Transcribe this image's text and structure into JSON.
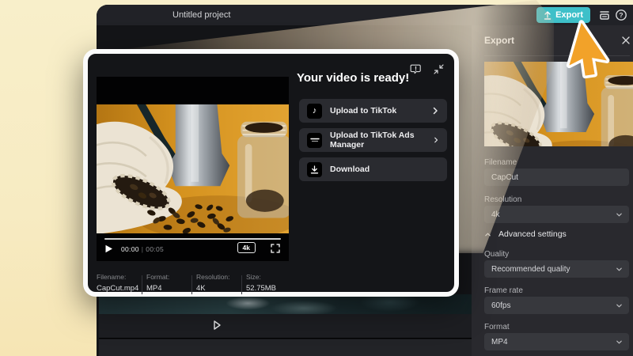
{
  "topbar": {
    "title": "Untitled project",
    "export_button": "Export",
    "help_glyph": "?"
  },
  "panel": {
    "title": "Export",
    "filename_label": "Filename",
    "filename_value": "CapCut",
    "resolution_label": "Resolution",
    "resolution_value": "4k",
    "advanced_label": "Advanced settings",
    "quality_label": "Quality",
    "quality_value": "Recommended quality",
    "framerate_label": "Frame rate",
    "framerate_value": "60fps",
    "format_label": "Format",
    "format_value": "MP4"
  },
  "modal": {
    "heading": "Your video is ready!",
    "actions": [
      {
        "label": "Upload to TikTok",
        "icon": "tiktok-icon"
      },
      {
        "label": "Upload to TikTok Ads Manager",
        "icon": "tiktok-ads-icon"
      },
      {
        "label": "Download",
        "icon": "download-icon"
      }
    ],
    "player": {
      "current_time": "00:00",
      "divider": "|",
      "duration": "00:05",
      "quality_badge": "4k"
    },
    "meta": [
      {
        "label": "Filename:",
        "value": "CapCut.mp4"
      },
      {
        "label": "Format:",
        "value": "MP4"
      },
      {
        "label": "Resolution:",
        "value": "4K"
      },
      {
        "label": "Size:",
        "value": "52.75MB"
      }
    ]
  },
  "icons": {
    "tiktok_note": "♪"
  },
  "colors": {
    "accent_teal": "#3ec0c9",
    "cream_backdrop": "#f7ebc2",
    "cursor_orange": "#f2a229",
    "modal_border": "#fbfbfb"
  }
}
